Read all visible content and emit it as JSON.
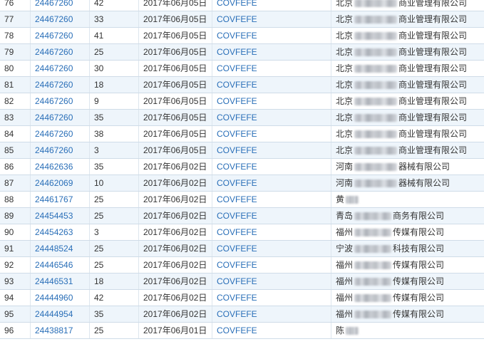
{
  "rows": [
    {
      "no": "76",
      "reg": "24467260",
      "cls": "42",
      "date": "2017年06月05日",
      "mark": "COVFEFE",
      "app_pre": "北京",
      "app_post": "商业管理有限公司",
      "blur": "long"
    },
    {
      "no": "77",
      "reg": "24467260",
      "cls": "33",
      "date": "2017年06月05日",
      "mark": "COVFEFE",
      "app_pre": "北京",
      "app_post": "商业管理有限公司",
      "blur": "long"
    },
    {
      "no": "78",
      "reg": "24467260",
      "cls": "41",
      "date": "2017年06月05日",
      "mark": "COVFEFE",
      "app_pre": "北京",
      "app_post": "商业管理有限公司",
      "blur": "long"
    },
    {
      "no": "79",
      "reg": "24467260",
      "cls": "25",
      "date": "2017年06月05日",
      "mark": "COVFEFE",
      "app_pre": "北京",
      "app_post": "商业管理有限公司",
      "blur": "long"
    },
    {
      "no": "80",
      "reg": "24467260",
      "cls": "30",
      "date": "2017年06月05日",
      "mark": "COVFEFE",
      "app_pre": "北京",
      "app_post": "商业管理有限公司",
      "blur": "long"
    },
    {
      "no": "81",
      "reg": "24467260",
      "cls": "18",
      "date": "2017年06月05日",
      "mark": "COVFEFE",
      "app_pre": "北京",
      "app_post": "商业管理有限公司",
      "blur": "long"
    },
    {
      "no": "82",
      "reg": "24467260",
      "cls": "9",
      "date": "2017年06月05日",
      "mark": "COVFEFE",
      "app_pre": "北京",
      "app_post": "商业管理有限公司",
      "blur": "long"
    },
    {
      "no": "83",
      "reg": "24467260",
      "cls": "35",
      "date": "2017年06月05日",
      "mark": "COVFEFE",
      "app_pre": "北京",
      "app_post": "商业管理有限公司",
      "blur": "long"
    },
    {
      "no": "84",
      "reg": "24467260",
      "cls": "38",
      "date": "2017年06月05日",
      "mark": "COVFEFE",
      "app_pre": "北京",
      "app_post": "商业管理有限公司",
      "blur": "long"
    },
    {
      "no": "85",
      "reg": "24467260",
      "cls": "3",
      "date": "2017年06月05日",
      "mark": "COVFEFE",
      "app_pre": "北京",
      "app_post": "商业管理有限公司",
      "blur": "long"
    },
    {
      "no": "86",
      "reg": "24462636",
      "cls": "35",
      "date": "2017年06月02日",
      "mark": "COVFEFE",
      "app_pre": "河南",
      "app_post": "器械有限公司",
      "blur": "long"
    },
    {
      "no": "87",
      "reg": "24462069",
      "cls": "10",
      "date": "2017年06月02日",
      "mark": "COVFEFE",
      "app_pre": "河南",
      "app_post": "器械有限公司",
      "blur": "long"
    },
    {
      "no": "88",
      "reg": "24461767",
      "cls": "25",
      "date": "2017年06月02日",
      "mark": "COVFEFE",
      "app_pre": "黄",
      "app_post": "",
      "blur": "short"
    },
    {
      "no": "89",
      "reg": "24454453",
      "cls": "25",
      "date": "2017年06月02日",
      "mark": "COVFEFE",
      "app_pre": "青岛",
      "app_post": "商务有限公司",
      "blur": "mid"
    },
    {
      "no": "90",
      "reg": "24454263",
      "cls": "3",
      "date": "2017年06月02日",
      "mark": "COVFEFE",
      "app_pre": "福州",
      "app_post": "传媒有限公司",
      "blur": "mid"
    },
    {
      "no": "91",
      "reg": "24448524",
      "cls": "25",
      "date": "2017年06月02日",
      "mark": "COVFEFE",
      "app_pre": "宁波",
      "app_post": "科技有限公司",
      "blur": "mid"
    },
    {
      "no": "92",
      "reg": "24446546",
      "cls": "25",
      "date": "2017年06月02日",
      "mark": "COVFEFE",
      "app_pre": "福州",
      "app_post": "传媒有限公司",
      "blur": "mid"
    },
    {
      "no": "93",
      "reg": "24446531",
      "cls": "18",
      "date": "2017年06月02日",
      "mark": "COVFEFE",
      "app_pre": "福州",
      "app_post": "传媒有限公司",
      "blur": "mid"
    },
    {
      "no": "94",
      "reg": "24444960",
      "cls": "42",
      "date": "2017年06月02日",
      "mark": "COVFEFE",
      "app_pre": "福州",
      "app_post": "传媒有限公司",
      "blur": "mid"
    },
    {
      "no": "95",
      "reg": "24444954",
      "cls": "35",
      "date": "2017年06月02日",
      "mark": "COVFEFE",
      "app_pre": "福州",
      "app_post": "传媒有限公司",
      "blur": "mid"
    },
    {
      "no": "96",
      "reg": "24438817",
      "cls": "25",
      "date": "2017年06月01日",
      "mark": "COVFEFE",
      "app_pre": "陈",
      "app_post": "",
      "blur": "short"
    }
  ],
  "colors": {
    "link": "#2a6fb8",
    "row_alt": "#eef5fb",
    "border": "#cfdce8"
  }
}
